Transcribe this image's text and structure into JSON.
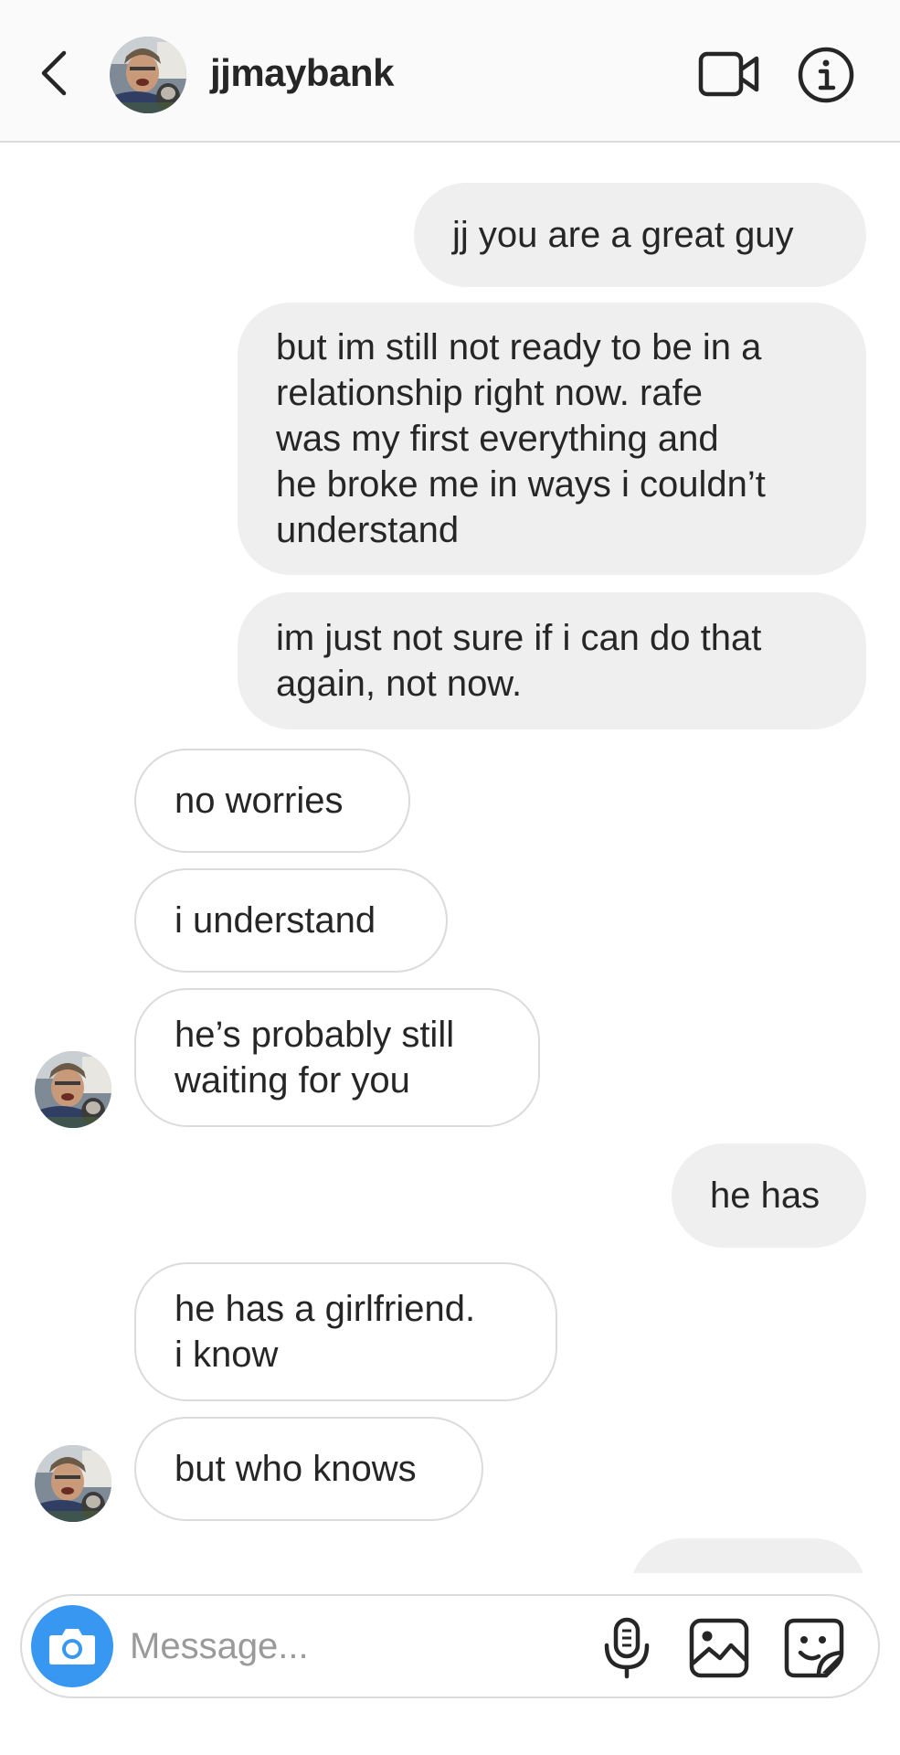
{
  "header": {
    "username": "jjmaybank",
    "back_icon": "chevron-left-icon",
    "video_icon": "video-camera-icon",
    "info_icon": "info-icon"
  },
  "messages": [
    {
      "direction": "sent",
      "text": "jj you are a great guy"
    },
    {
      "direction": "sent",
      "lines": [
        "but im still not ready to be in a",
        "relationship right now. rafe",
        "was my first everything and",
        "he broke me in ways i couldn’t",
        "understand"
      ]
    },
    {
      "direction": "sent",
      "lines": [
        "im just not sure if i can do that",
        "again, not now."
      ]
    },
    {
      "direction": "received",
      "text": "no worries"
    },
    {
      "direction": "received",
      "text": "i understand"
    },
    {
      "direction": "received",
      "lines": [
        "he’s probably still",
        "waiting for you"
      ]
    },
    {
      "direction": "sent",
      "text": "he has"
    },
    {
      "direction": "received",
      "lines": [
        "he has a girlfriend.",
        "i know"
      ]
    },
    {
      "direction": "received",
      "text": "but who knows"
    },
    {
      "direction": "sent",
      "text": ""
    }
  ],
  "composer": {
    "placeholder": "Message...",
    "camera_icon": "camera-icon",
    "mic_icon": "microphone-icon",
    "gallery_icon": "image-gallery-icon",
    "sticker_icon": "sticker-icon"
  },
  "colors": {
    "header_bg": "#fafafa",
    "sent_bubble": "#efefef",
    "received_border": "#dbdbdb",
    "camera_button": "#3897f0",
    "text": "#262626",
    "placeholder": "#9a9a9a"
  }
}
